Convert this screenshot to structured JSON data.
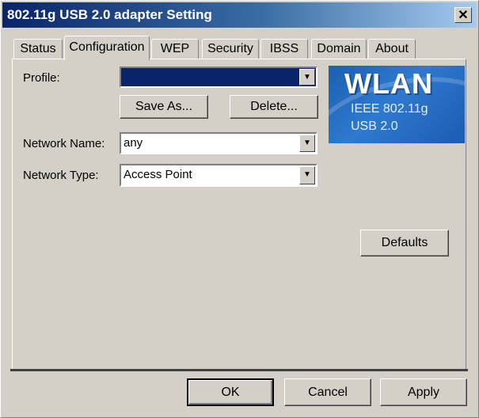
{
  "window": {
    "title": "802.11g USB 2.0 adapter Setting",
    "close_glyph": "✕"
  },
  "tabs": [
    {
      "label": "Status"
    },
    {
      "label": "Configuration"
    },
    {
      "label": "WEP"
    },
    {
      "label": "Security"
    },
    {
      "label": "IBSS"
    },
    {
      "label": "Domain"
    },
    {
      "label": "About"
    }
  ],
  "active_tab": "Configuration",
  "config": {
    "profile_label": "Profile:",
    "profile_value": "",
    "save_as_label": "Save As...",
    "delete_label": "Delete...",
    "network_name_label": "Network Name:",
    "network_name_value": "any",
    "network_type_label": "Network Type:",
    "network_type_value": "Access Point",
    "defaults_label": "Defaults"
  },
  "logo": {
    "line1": "WLAN",
    "line2": "IEEE 802.11g",
    "line3": "USB 2.0"
  },
  "footer": {
    "ok_label": "OK",
    "cancel_label": "Cancel",
    "apply_label": "Apply"
  },
  "colors": {
    "titlebar_start": "#0a246a",
    "face": "#d4d0c8",
    "selection": "#0a246a"
  }
}
